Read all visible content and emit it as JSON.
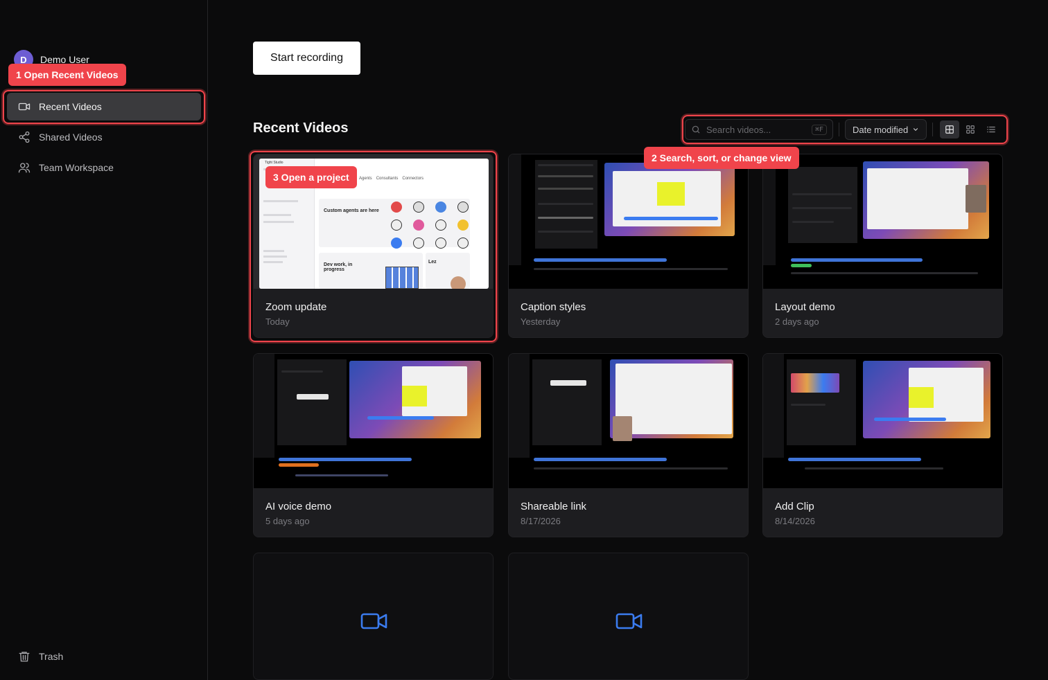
{
  "user": {
    "initial": "D",
    "name": "Demo User"
  },
  "callouts": {
    "one": "1 Open Recent Videos",
    "two": "2 Search, sort, or change view",
    "three": "3 Open a project"
  },
  "nav": [
    {
      "label": "Recent Videos",
      "icon": "video-camera-icon",
      "active": true
    },
    {
      "label": "Shared Videos",
      "icon": "share-icon"
    },
    {
      "label": "Team Workspace",
      "icon": "users-icon"
    }
  ],
  "trash_label": "Trash",
  "start_recording_label": "Start recording",
  "section_title": "Recent Videos",
  "search": {
    "placeholder": "Search videos...",
    "shortcut": "⌘F"
  },
  "sort": {
    "selected": "Date modified"
  },
  "view_modes": [
    "large-grid-icon",
    "small-grid-icon",
    "list-icon"
  ],
  "videos": [
    {
      "title": "Zoom update",
      "date": "Today"
    },
    {
      "title": "Caption styles",
      "date": "Yesterday"
    },
    {
      "title": "Layout demo",
      "date": "2 days ago"
    },
    {
      "title": "AI voice demo",
      "date": "5 days ago"
    },
    {
      "title": "Shareable link",
      "date": "8/17/2026"
    },
    {
      "title": "Add Clip",
      "date": "8/14/2026"
    }
  ],
  "zoom_thumb": {
    "app_name": "Tight Studio",
    "tabs": [
      "Agents",
      "Consultants",
      "Connectors"
    ],
    "card1_title": "Custom agents are here",
    "card2_title": "Dev work, in progress",
    "card3_title": "Lez"
  },
  "colors": {
    "accent_red": "#f0444b",
    "empty_icon_blue": "#3b7cf0"
  }
}
